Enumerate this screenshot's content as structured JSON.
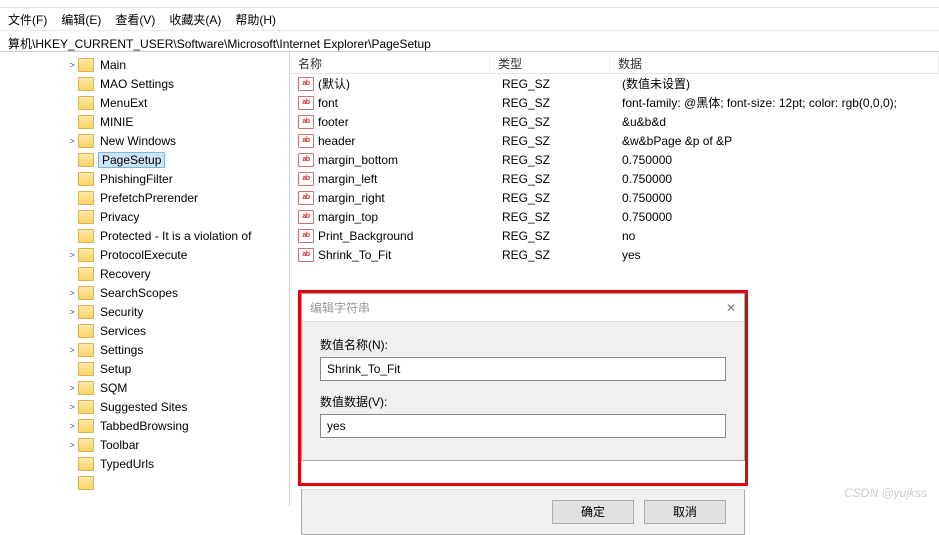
{
  "menubar": {
    "file": "文件(F)",
    "edit": "编辑(E)",
    "view": "查看(V)",
    "fav": "收藏夹(A)",
    "help": "帮助(H)"
  },
  "path": "算机\\HKEY_CURRENT_USER\\Software\\Microsoft\\Internet Explorer\\PageSetup",
  "tree": [
    {
      "chev": ">",
      "label": "Main"
    },
    {
      "chev": "",
      "label": "MAO Settings"
    },
    {
      "chev": "",
      "label": "MenuExt"
    },
    {
      "chev": "",
      "label": "MINIE"
    },
    {
      "chev": ">",
      "label": "New Windows"
    },
    {
      "chev": "",
      "label": "PageSetup",
      "selected": true
    },
    {
      "chev": "",
      "label": "PhishingFilter"
    },
    {
      "chev": "",
      "label": "PrefetchPrerender"
    },
    {
      "chev": "",
      "label": "Privacy"
    },
    {
      "chev": "",
      "label": "Protected - It is a violation of"
    },
    {
      "chev": ">",
      "label": "ProtocolExecute"
    },
    {
      "chev": "",
      "label": "Recovery"
    },
    {
      "chev": ">",
      "label": "SearchScopes"
    },
    {
      "chev": ">",
      "label": "Security"
    },
    {
      "chev": "",
      "label": "Services"
    },
    {
      "chev": ">",
      "label": "Settings"
    },
    {
      "chev": "",
      "label": "Setup"
    },
    {
      "chev": ">",
      "label": "SQM"
    },
    {
      "chev": ">",
      "label": "Suggested Sites"
    },
    {
      "chev": ">",
      "label": "TabbedBrowsing"
    },
    {
      "chev": ">",
      "label": "Toolbar"
    },
    {
      "chev": "",
      "label": "TypedUrls"
    },
    {
      "chev": "",
      "label": " "
    }
  ],
  "columns": {
    "name": "名称",
    "type": "类型",
    "data": "数据"
  },
  "rows": [
    {
      "name": "(默认)",
      "type": "REG_SZ",
      "data": "(数值未设置)"
    },
    {
      "name": "font",
      "type": "REG_SZ",
      "data": "font-family: @黑体; font-size: 12pt; color: rgb(0,0,0);"
    },
    {
      "name": "footer",
      "type": "REG_SZ",
      "data": "&u&b&d"
    },
    {
      "name": "header",
      "type": "REG_SZ",
      "data": "&w&bPage &p of &P"
    },
    {
      "name": "margin_bottom",
      "type": "REG_SZ",
      "data": "0.750000"
    },
    {
      "name": "margin_left",
      "type": "REG_SZ",
      "data": "0.750000"
    },
    {
      "name": "margin_right",
      "type": "REG_SZ",
      "data": "0.750000"
    },
    {
      "name": "margin_top",
      "type": "REG_SZ",
      "data": "0.750000"
    },
    {
      "name": "Print_Background",
      "type": "REG_SZ",
      "data": "no"
    },
    {
      "name": "Shrink_To_Fit",
      "type": "REG_SZ",
      "data": "yes"
    }
  ],
  "dialog": {
    "title": "编辑字符串",
    "name_label": "数值名称(N):",
    "name_value": "Shrink_To_Fit",
    "data_label": "数值数据(V):",
    "data_value": "yes",
    "ok": "确定",
    "cancel": "取消"
  },
  "watermark": "CSDN @yujkss"
}
